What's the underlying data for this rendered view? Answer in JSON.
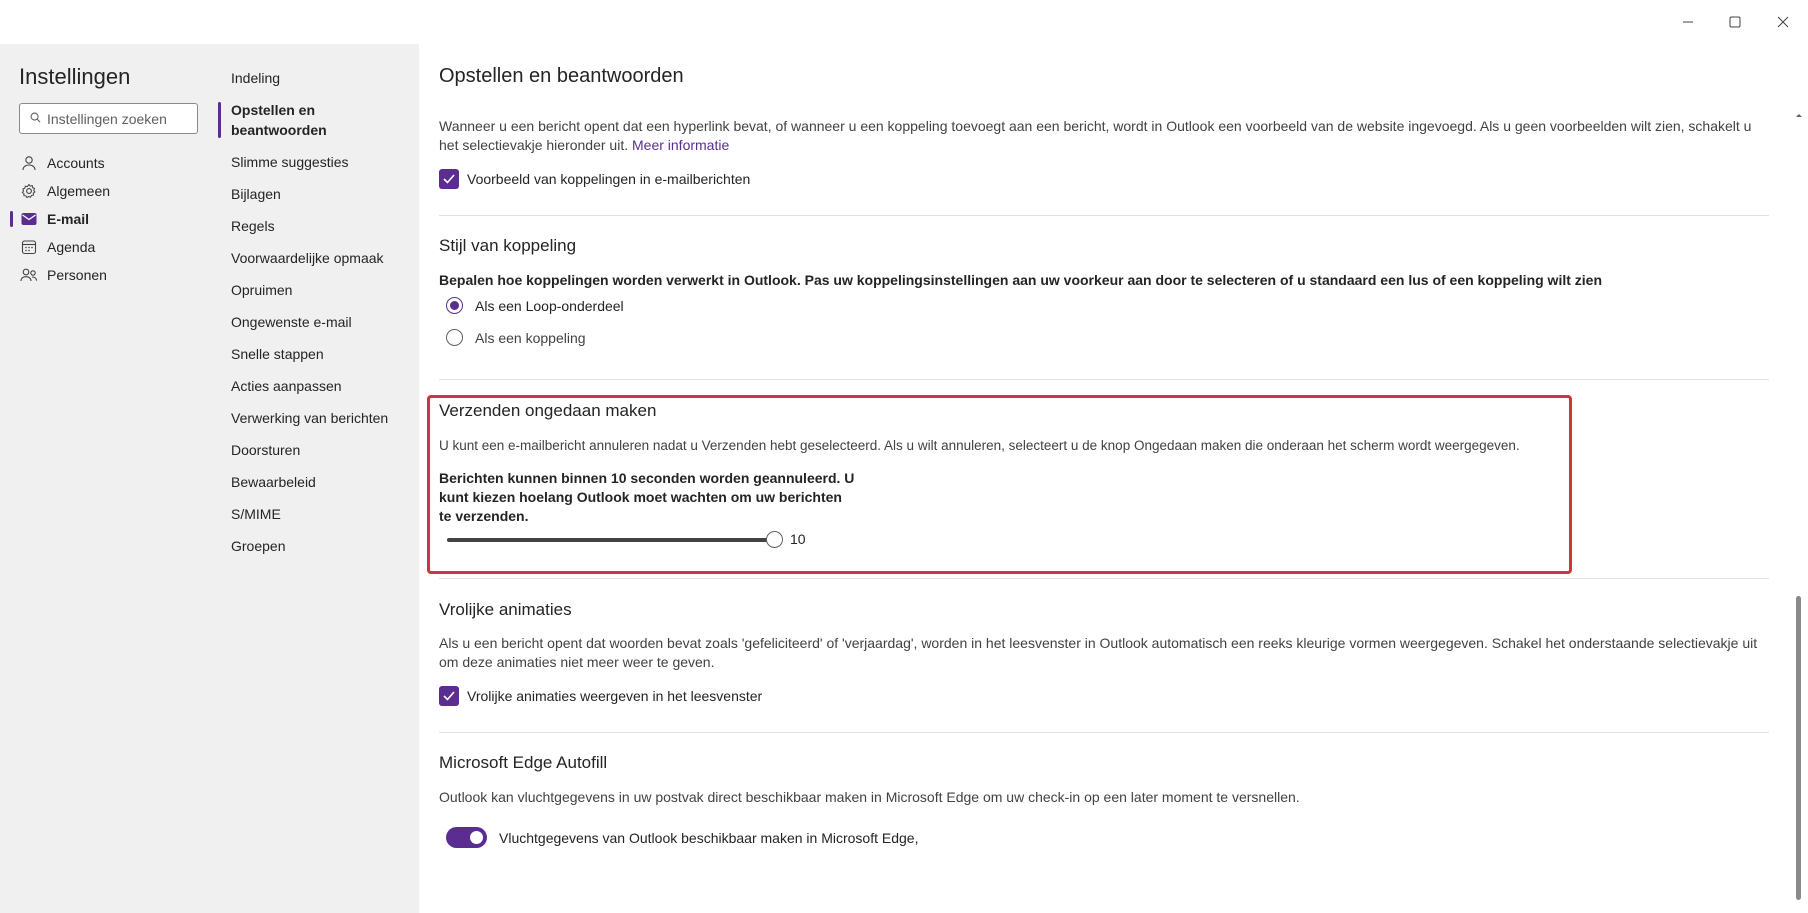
{
  "window": {
    "minimize_icon": "minimize-icon",
    "maximize_icon": "maximize-icon",
    "close_icon": "close-icon"
  },
  "sidebar": {
    "title": "Instellingen",
    "search_placeholder": "Instellingen zoeken",
    "categories": [
      {
        "label": "Accounts",
        "icon": "person-icon"
      },
      {
        "label": "Algemeen",
        "icon": "gear-icon"
      },
      {
        "label": "E-mail",
        "icon": "mail-icon"
      },
      {
        "label": "Agenda",
        "icon": "calendar-icon"
      },
      {
        "label": "Personen",
        "icon": "people-icon"
      }
    ]
  },
  "subnav": {
    "items": [
      "Indeling",
      "Opstellen en beantwoorden",
      "Slimme suggesties",
      "Bijlagen",
      "Regels",
      "Voorwaardelijke opmaak",
      "Opruimen",
      "Ongewenste e-mail",
      "Snelle stappen",
      "Acties aanpassen",
      "Verwerking van berichten",
      "Doorsturen",
      "Bewaarbeleid",
      "S/MIME",
      "Groepen"
    ]
  },
  "main": {
    "title": "Opstellen en beantwoorden",
    "link_preview": {
      "description": "Wanneer u een bericht opent dat een hyperlink bevat, of wanneer u een koppeling toevoegt aan een bericht, wordt in Outlook een voorbeeld van de website ingevoegd. Als u geen voorbeelden wilt zien, schakelt u het selectievakje hieronder uit.",
      "more_info": "Meer informatie",
      "checkbox_label": "Voorbeeld van koppelingen in e-mailberichten"
    },
    "link_style": {
      "heading": "Stijl van koppeling",
      "description": "Bepalen hoe koppelingen worden verwerkt in Outlook. Pas uw koppelingsinstellingen aan uw voorkeur aan door te selecteren of u standaard een lus of een koppeling wilt zien",
      "option1": "Als een Loop-onderdeel",
      "option2": "Als een koppeling"
    },
    "undo_send": {
      "heading": "Verzenden ongedaan maken",
      "description": "U kunt een e-mailbericht annuleren nadat u Verzenden hebt geselecteerd. Als u wilt annuleren, selecteert u de knop Ongedaan maken die onderaan het scherm wordt weergegeven.",
      "bold_line1": "Berichten kunnen binnen 10 seconden worden geannuleerd. U",
      "bold_line2": "kunt kiezen hoelang Outlook moet wachten om uw berichten",
      "bold_line3": "te verzenden.",
      "slider_value": "10"
    },
    "animations": {
      "heading": "Vrolijke animaties",
      "description_line1": "Als u een bericht opent dat woorden bevat zoals 'gefeliciteerd' of 'verjaardag', worden in het leesvenster in Outlook automatisch een reeks kleurige vormen weergegeven. Schakel het onderstaande selectievakje uit",
      "description_line2": "om deze animaties niet meer weer te geven.",
      "checkbox_label": "Vrolijke animaties weergeven in het leesvenster"
    },
    "edge_autofill": {
      "heading": "Microsoft Edge Autofill",
      "description": "Outlook kan vluchtgegevens in uw postvak direct beschikbaar maken in Microsoft Edge om uw check-in op een later moment te versnellen.",
      "toggle_label": "Vluchtgegevens van Outlook beschikbaar maken in Microsoft Edge,"
    }
  },
  "colors": {
    "accent": "#5c2d91",
    "highlight_border": "#d13438"
  }
}
